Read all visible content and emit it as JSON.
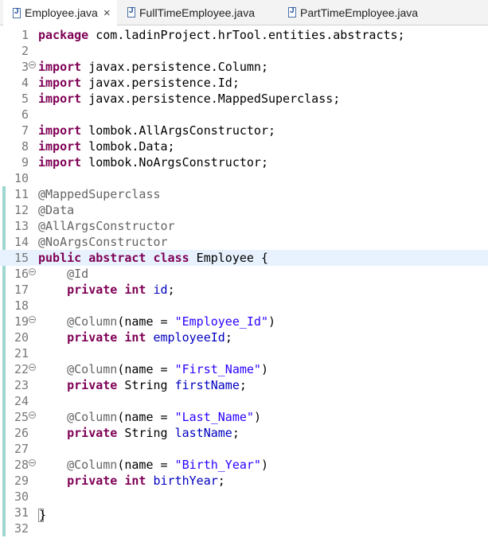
{
  "tabs": [
    {
      "label": "Employee.java",
      "active": true,
      "closable": true
    },
    {
      "label": "FullTimeEmployee.java",
      "active": false,
      "closable": false
    },
    {
      "label": "PartTimeEmployee.java",
      "active": false,
      "closable": false
    }
  ],
  "tab_close_glyph": "×",
  "editor": {
    "colors": {
      "keyword": "#7f0055",
      "annotation": "#646464",
      "field": "#0000c0",
      "string": "#2a00ff",
      "current_line": "#e8f2fe",
      "change_bar": "#9fd6cf"
    },
    "lines": [
      {
        "n": "1",
        "fold": false,
        "tokens": [
          {
            "t": "kw",
            "s": "package"
          },
          {
            "t": "p",
            "s": " com.ladinProject.hrTool.entities.abstracts;"
          }
        ]
      },
      {
        "n": "2",
        "fold": false,
        "tokens": []
      },
      {
        "n": "3",
        "fold": true,
        "tokens": [
          {
            "t": "kw",
            "s": "import"
          },
          {
            "t": "p",
            "s": " javax.persistence.Column;"
          }
        ]
      },
      {
        "n": "4",
        "fold": false,
        "tokens": [
          {
            "t": "kw",
            "s": "import"
          },
          {
            "t": "p",
            "s": " javax.persistence.Id;"
          }
        ]
      },
      {
        "n": "5",
        "fold": false,
        "tokens": [
          {
            "t": "kw",
            "s": "import"
          },
          {
            "t": "p",
            "s": " javax.persistence.MappedSuperclass;"
          }
        ]
      },
      {
        "n": "6",
        "fold": false,
        "tokens": []
      },
      {
        "n": "7",
        "fold": false,
        "tokens": [
          {
            "t": "kw",
            "s": "import"
          },
          {
            "t": "p",
            "s": " lombok.AllArgsConstructor;"
          }
        ]
      },
      {
        "n": "8",
        "fold": false,
        "tokens": [
          {
            "t": "kw",
            "s": "import"
          },
          {
            "t": "p",
            "s": " lombok.Data;"
          }
        ]
      },
      {
        "n": "9",
        "fold": false,
        "tokens": [
          {
            "t": "kw",
            "s": "import"
          },
          {
            "t": "p",
            "s": " lombok.NoArgsConstructor;"
          }
        ]
      },
      {
        "n": "10",
        "fold": false,
        "tokens": []
      },
      {
        "n": "11",
        "fold": false,
        "tokens": [
          {
            "t": "ann",
            "s": "@MappedSuperclass"
          }
        ]
      },
      {
        "n": "12",
        "fold": false,
        "tokens": [
          {
            "t": "ann",
            "s": "@Data"
          }
        ]
      },
      {
        "n": "13",
        "fold": false,
        "tokens": [
          {
            "t": "ann",
            "s": "@AllArgsConstructor"
          }
        ]
      },
      {
        "n": "14",
        "fold": false,
        "tokens": [
          {
            "t": "ann",
            "s": "@NoArgsConstructor"
          }
        ]
      },
      {
        "n": "15",
        "fold": false,
        "current": true,
        "tokens": [
          {
            "t": "kw",
            "s": "public"
          },
          {
            "t": "p",
            "s": " "
          },
          {
            "t": "kw",
            "s": "abstract"
          },
          {
            "t": "p",
            "s": " "
          },
          {
            "t": "kw",
            "s": "class"
          },
          {
            "t": "p",
            "s": " Employee {"
          }
        ]
      },
      {
        "n": "16",
        "fold": true,
        "tokens": [
          {
            "t": "p",
            "s": "    "
          },
          {
            "t": "ann",
            "s": "@Id"
          }
        ]
      },
      {
        "n": "17",
        "fold": false,
        "tokens": [
          {
            "t": "p",
            "s": "    "
          },
          {
            "t": "kw",
            "s": "private"
          },
          {
            "t": "p",
            "s": " "
          },
          {
            "t": "kw",
            "s": "int"
          },
          {
            "t": "p",
            "s": " "
          },
          {
            "t": "fld",
            "s": "id"
          },
          {
            "t": "p",
            "s": ";"
          }
        ]
      },
      {
        "n": "18",
        "fold": false,
        "tokens": []
      },
      {
        "n": "19",
        "fold": true,
        "tokens": [
          {
            "t": "p",
            "s": "    "
          },
          {
            "t": "ann",
            "s": "@Column"
          },
          {
            "t": "p",
            "s": "(name = "
          },
          {
            "t": "str",
            "s": "\"Employee_Id\""
          },
          {
            "t": "p",
            "s": ")"
          }
        ]
      },
      {
        "n": "20",
        "fold": false,
        "tokens": [
          {
            "t": "p",
            "s": "    "
          },
          {
            "t": "kw",
            "s": "private"
          },
          {
            "t": "p",
            "s": " "
          },
          {
            "t": "kw",
            "s": "int"
          },
          {
            "t": "p",
            "s": " "
          },
          {
            "t": "fld",
            "s": "employeeId"
          },
          {
            "t": "p",
            "s": ";"
          }
        ]
      },
      {
        "n": "21",
        "fold": false,
        "tokens": []
      },
      {
        "n": "22",
        "fold": true,
        "tokens": [
          {
            "t": "p",
            "s": "    "
          },
          {
            "t": "ann",
            "s": "@Column"
          },
          {
            "t": "p",
            "s": "(name = "
          },
          {
            "t": "str",
            "s": "\"First_Name\""
          },
          {
            "t": "p",
            "s": ")"
          }
        ]
      },
      {
        "n": "23",
        "fold": false,
        "tokens": [
          {
            "t": "p",
            "s": "    "
          },
          {
            "t": "kw",
            "s": "private"
          },
          {
            "t": "p",
            "s": " String "
          },
          {
            "t": "fld",
            "s": "firstName"
          },
          {
            "t": "p",
            "s": ";"
          }
        ]
      },
      {
        "n": "24",
        "fold": false,
        "tokens": []
      },
      {
        "n": "25",
        "fold": true,
        "tokens": [
          {
            "t": "p",
            "s": "    "
          },
          {
            "t": "ann",
            "s": "@Column"
          },
          {
            "t": "p",
            "s": "(name = "
          },
          {
            "t": "str",
            "s": "\"Last_Name\""
          },
          {
            "t": "p",
            "s": ")"
          }
        ]
      },
      {
        "n": "26",
        "fold": false,
        "tokens": [
          {
            "t": "p",
            "s": "    "
          },
          {
            "t": "kw",
            "s": "private"
          },
          {
            "t": "p",
            "s": " String "
          },
          {
            "t": "fld",
            "s": "lastName"
          },
          {
            "t": "p",
            "s": ";"
          }
        ]
      },
      {
        "n": "27",
        "fold": false,
        "tokens": []
      },
      {
        "n": "28",
        "fold": true,
        "tokens": [
          {
            "t": "p",
            "s": "    "
          },
          {
            "t": "ann",
            "s": "@Column"
          },
          {
            "t": "p",
            "s": "(name = "
          },
          {
            "t": "str",
            "s": "\"Birth_Year\""
          },
          {
            "t": "p",
            "s": ")"
          }
        ]
      },
      {
        "n": "29",
        "fold": false,
        "tokens": [
          {
            "t": "p",
            "s": "    "
          },
          {
            "t": "kw",
            "s": "private"
          },
          {
            "t": "p",
            "s": " "
          },
          {
            "t": "kw",
            "s": "int"
          },
          {
            "t": "p",
            "s": " "
          },
          {
            "t": "fld",
            "s": "birthYear"
          },
          {
            "t": "p",
            "s": ";"
          }
        ]
      },
      {
        "n": "30",
        "fold": false,
        "tokens": []
      },
      {
        "n": "31",
        "fold": false,
        "tokens": [
          {
            "t": "brace",
            "s": "}"
          }
        ]
      },
      {
        "n": "32",
        "fold": false,
        "tokens": []
      }
    ],
    "change_bar_lines": [
      "11",
      "12",
      "13",
      "14",
      "15",
      "16",
      "17",
      "18",
      "19",
      "20",
      "21",
      "22",
      "23",
      "24",
      "25",
      "26",
      "27",
      "28",
      "29",
      "30",
      "31",
      "32"
    ]
  }
}
